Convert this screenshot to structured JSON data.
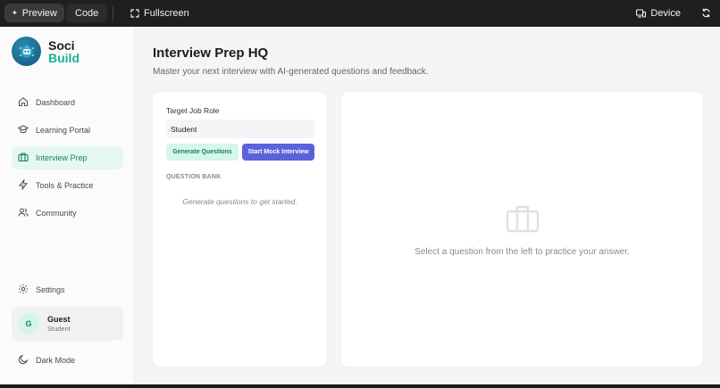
{
  "topbar": {
    "preview_label": "Preview",
    "code_label": "Code",
    "fullscreen_label": "Fullscreen",
    "device_label": "Device"
  },
  "brand": {
    "line1": "Soci",
    "line2": "Build"
  },
  "sidebar": {
    "items": [
      {
        "label": "Dashboard",
        "icon": "home-icon"
      },
      {
        "label": "Learning Portal",
        "icon": "graduation-cap-icon"
      },
      {
        "label": "Interview Prep",
        "icon": "briefcase-icon",
        "active": true
      },
      {
        "label": "Tools & Practice",
        "icon": "lightning-icon"
      },
      {
        "label": "Community",
        "icon": "users-icon"
      }
    ],
    "settings_label": "Settings",
    "dark_mode_label": "Dark Mode"
  },
  "user": {
    "initial": "G",
    "name": "Guest",
    "role": "Student"
  },
  "page": {
    "title": "Interview Prep HQ",
    "subtitle": "Master your next interview with AI-generated questions and feedback."
  },
  "form": {
    "role_label": "Target Job Role",
    "role_value": "Student",
    "generate_label": "Generate Questions",
    "mock_label": "Start Mock Interview"
  },
  "question_bank": {
    "heading": "QUESTION BANK",
    "empty_text": "Generate questions to get started."
  },
  "practice": {
    "placeholder_text": "Select a question from the left to practice your answer."
  },
  "colors": {
    "accent": "#19b394",
    "primary_button": "#5b62dc",
    "active_bg": "#e4f7f1"
  }
}
